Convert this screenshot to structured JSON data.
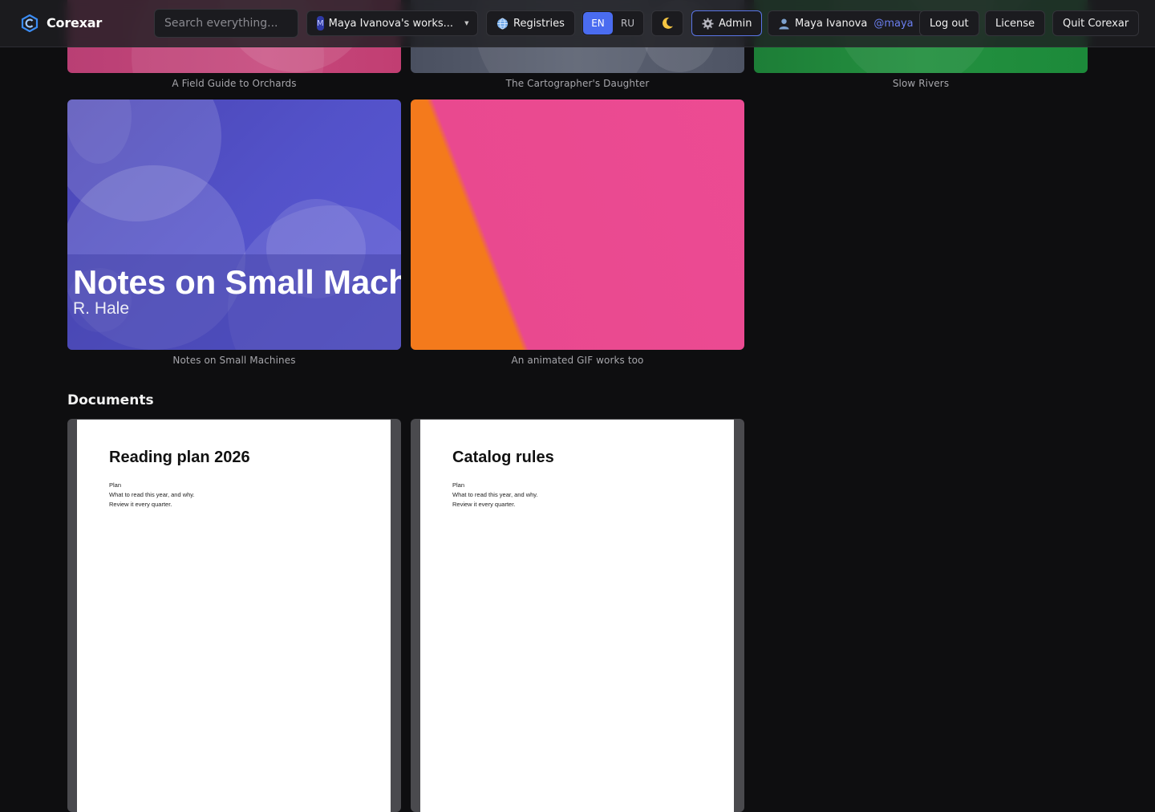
{
  "header": {
    "brand": "Corexar",
    "search_placeholder": "Search everything...",
    "workspace": {
      "badge": "M",
      "label": "Maya Ivanova's works..."
    },
    "registries_label": "Registries",
    "languages": [
      "EN",
      "RU"
    ],
    "active_language": "EN",
    "theme_icon": "moon-icon",
    "admin_label": "Admin",
    "user": {
      "name": "Maya Ivanova",
      "handle": "@maya"
    },
    "logout_label": "Log out",
    "license_label": "License",
    "quit_label": "Quit Corexar"
  },
  "gallery": {
    "top_row": [
      {
        "caption": "A Field Guide to Orchards"
      },
      {
        "caption": "The Cartographer's Daughter"
      },
      {
        "caption": "Slow Rivers"
      }
    ],
    "cards": [
      {
        "cover_title": "Notes on Small Machi",
        "cover_author": "R. Hale",
        "caption": "Notes on Small Machines"
      },
      {
        "caption": "An animated GIF works too"
      }
    ]
  },
  "documents": {
    "title": "Documents",
    "items": [
      {
        "title": "Reading plan 2026",
        "lines": [
          "Plan",
          "What to read this year, and why.",
          "Review it every quarter."
        ]
      },
      {
        "title": "Catalog rules",
        "lines": [
          "Plan",
          "What to read this year, and why.",
          "Review it every quarter."
        ]
      }
    ]
  },
  "colors": {
    "accent": "#4a6cf0",
    "handle": "#6b7ff0",
    "background": "#0e0e10"
  }
}
